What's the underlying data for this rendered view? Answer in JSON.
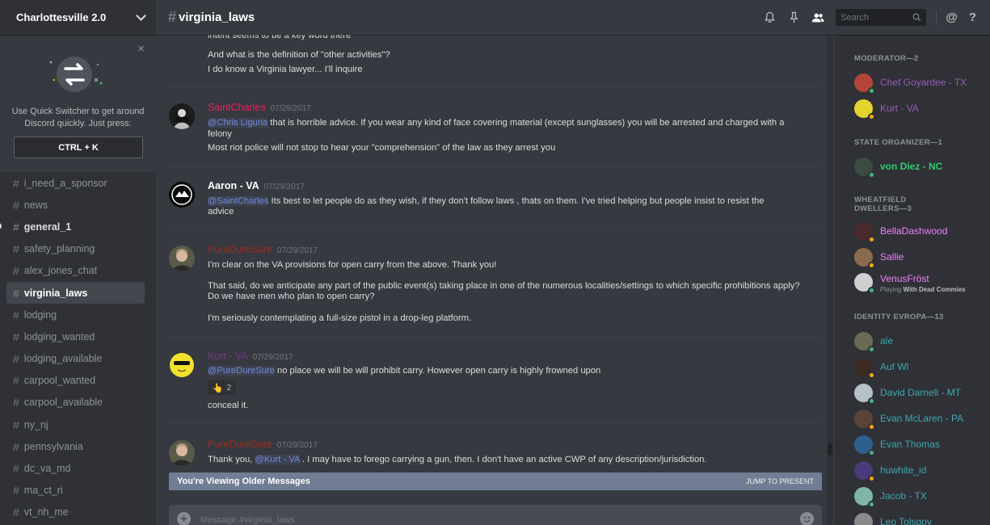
{
  "server": {
    "name": "Charlottesville 2.0"
  },
  "quick_switcher": {
    "text": "Use Quick Switcher to get around Discord quickly. Just press:",
    "keys": "CTRL + K",
    "close": "×"
  },
  "channels": [
    {
      "name": "i_need_a_sponsor",
      "state": "normal"
    },
    {
      "name": "news",
      "state": "normal"
    },
    {
      "name": "general_1",
      "state": "unread"
    },
    {
      "name": "safety_planning",
      "state": "normal"
    },
    {
      "name": "alex_jones_chat",
      "state": "normal"
    },
    {
      "name": "virginia_laws",
      "state": "active"
    },
    {
      "name": "lodging",
      "state": "normal"
    },
    {
      "name": "lodging_wanted",
      "state": "normal"
    },
    {
      "name": "lodging_available",
      "state": "normal"
    },
    {
      "name": "carpool_wanted",
      "state": "normal"
    },
    {
      "name": "carpool_available",
      "state": "normal"
    },
    {
      "name": "ny_nj",
      "state": "normal"
    },
    {
      "name": "pennsylvania",
      "state": "normal"
    },
    {
      "name": "dc_va_md",
      "state": "normal"
    },
    {
      "name": "ma_ct_ri",
      "state": "normal"
    },
    {
      "name": "vt_nh_me",
      "state": "normal"
    }
  ],
  "header": {
    "channel": "virginia_laws",
    "search_placeholder": "Search",
    "at": "@",
    "help": "?"
  },
  "messages": {
    "partial": {
      "line0": "intent seems to be a key word there",
      "line1": "And what is the definition of \"other activities\"?",
      "line2": "I do know a Virginia lawyer... I'll inquire"
    },
    "m1": {
      "author": "SaintCharles",
      "color": "#e91e63",
      "time": "07/29/2017",
      "mention": "@Chris Liguria",
      "line1": " that is horrible advice. If you wear any kind of face covering material (except sunglasses) you will be arrested and charged with a",
      "line1b": "felony",
      "line2": "Most riot police will not stop to hear your \"comprehension\" of the law as they arrest you"
    },
    "m2": {
      "author": "Aaron - VA",
      "color": "#ffffff",
      "time": "07/29/2017",
      "mention": "@SaintCharles",
      "line1": " Its best to let people do as they wish,  if they don't follow laws , thats on them. I've tried helping but people insist to resist the",
      "line1b": "advice"
    },
    "m3": {
      "author": "PureDureSure",
      "color": "#992d22",
      "time": "07/29/2017",
      "line1": "I'm clear on the VA provisions for open carry from the above. Thank you!",
      "line2": "That said, do we anticipate any part of the public event(s) taking place in one of the numerous localities/settings to which specific prohibitions apply?",
      "line3": "Do we have men who plan to open carry?",
      "line4": "I'm seriously contemplating a full-size pistol in a drop-leg platform."
    },
    "m4": {
      "author": "Kurt - VA",
      "color": "#71368a",
      "time": "07/29/2017",
      "mention": "@PureDureSure",
      "line1": " no place we will be will prohibit carry. However open carry is highly frowned upon",
      "reaction_emoji": "👆",
      "reaction_count": "2",
      "line2": "conceal it."
    },
    "m5": {
      "author": "PureDureSure",
      "color": "#992d22",
      "time": "07/29/2017",
      "pre": "Thank you, ",
      "mention": "@Kurt - VA",
      "line1": " . I may have to forego carrying a gun, then. I don't have an active CWP of any description/jurisdiction."
    }
  },
  "older_bar": {
    "label": "You're Viewing Older Messages",
    "jump": "JUMP TO PRESENT"
  },
  "composer": {
    "placeholder": "Message #virginia_laws"
  },
  "members": {
    "groups": [
      {
        "label": "MODERATOR—2"
      },
      {
        "label": "STATE ORGANIZER—1"
      },
      {
        "label": "WHEATFIELD DWELLERS—3"
      },
      {
        "label": "IDENTITY EVROPA—13"
      }
    ],
    "list": [
      {
        "name": "Chef Goyardee - TX",
        "color": "#9b59b6",
        "status": "#43b581",
        "avatar": "#b5453a"
      },
      {
        "name": "Kurt - VA",
        "color": "#9b59b6",
        "status": "#faa61a",
        "avatar": "#e3d32e"
      },
      {
        "name": "von Diez - NC",
        "color": "#2ecc71",
        "status": "#43b581",
        "avatar": "#3c4a44"
      },
      {
        "name": "BellaDashwood",
        "color": "#f47fff",
        "status": "#faa61a",
        "avatar": "#4a2a2a"
      },
      {
        "name": "Sallie",
        "color": "#f47fff",
        "status": "#faa61a",
        "avatar": "#8c6a4c"
      },
      {
        "name": "VenusFröst",
        "color": "#f47fff",
        "status": "#43b581",
        "avatar": "#cfcfcf",
        "sub_prefix": "Playing ",
        "sub_game": "With Dead Commies"
      },
      {
        "name": "ale",
        "color": "#3fa7b0",
        "status": "#43b581",
        "avatar": "#6b6a55"
      },
      {
        "name": "Auf Wl",
        "color": "#3fa7b0",
        "status": "#faa61a",
        "avatar": "#3b2c22"
      },
      {
        "name": "David Darnell - MT",
        "color": "#3fa7b0",
        "status": "#43b581",
        "avatar": "#b7c0c7"
      },
      {
        "name": "Evan McLaren - PA",
        "color": "#3fa7b0",
        "status": "#faa61a",
        "avatar": "#5a4439"
      },
      {
        "name": "Evan Thomas",
        "color": "#3fa7b0",
        "status": "#43b581",
        "avatar": "#2f5f8f"
      },
      {
        "name": "huwhite_id",
        "color": "#3fa7b0",
        "status": "#faa61a",
        "avatar": "#4a3a7a"
      },
      {
        "name": "Jacob - TX",
        "color": "#3fa7b0",
        "status": "#43b581",
        "avatar": "#7fb5a9"
      },
      {
        "name": "Leo Tolsgoy",
        "color": "#3fa7b0",
        "status": "#43b581",
        "avatar": "#8a8a8a"
      }
    ]
  },
  "colors": {
    "mention": "#7289da",
    "online": "#43b581",
    "idle": "#faa61a",
    "active_channel_bg": "#42464d"
  },
  "icons": [
    "chevron-down-icon",
    "close-icon",
    "quick-switcher-arrows-icon",
    "hash-icon",
    "bell-icon",
    "pin-icon",
    "members-icon",
    "search-icon",
    "at-icon",
    "help-icon",
    "upload-icon",
    "emoji-icon"
  ]
}
